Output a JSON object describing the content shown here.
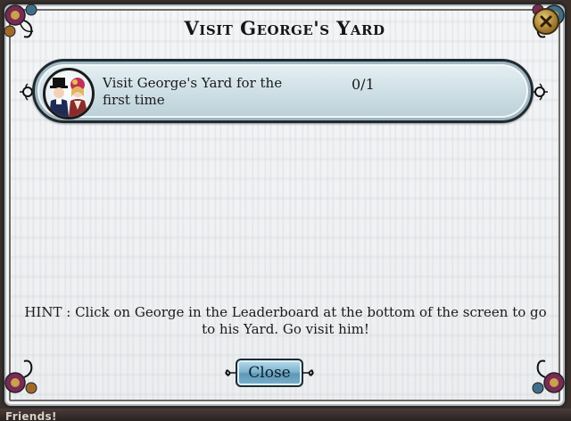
{
  "dialog": {
    "title": "Visit George's Yard",
    "close_icon": "close-x-icon"
  },
  "goal": {
    "portrait_icon": "character-portrait-icon",
    "text": "Visit George's Yard for the first time",
    "progress_text": "0/1",
    "progress_fraction": 0
  },
  "hint": {
    "text": "HINT : Click on George in the Leaderboard at the bottom of the screen to go to his Yard. Go visit him!"
  },
  "buttons": {
    "close_label": "Close"
  },
  "background": {
    "friends_label": "Friends!"
  },
  "colors": {
    "button_blue": "#7fb4cf",
    "goal_panel": "#cfe0e6",
    "gold_close": "#a07a2c",
    "frame_dark": "#2c2a2a"
  }
}
